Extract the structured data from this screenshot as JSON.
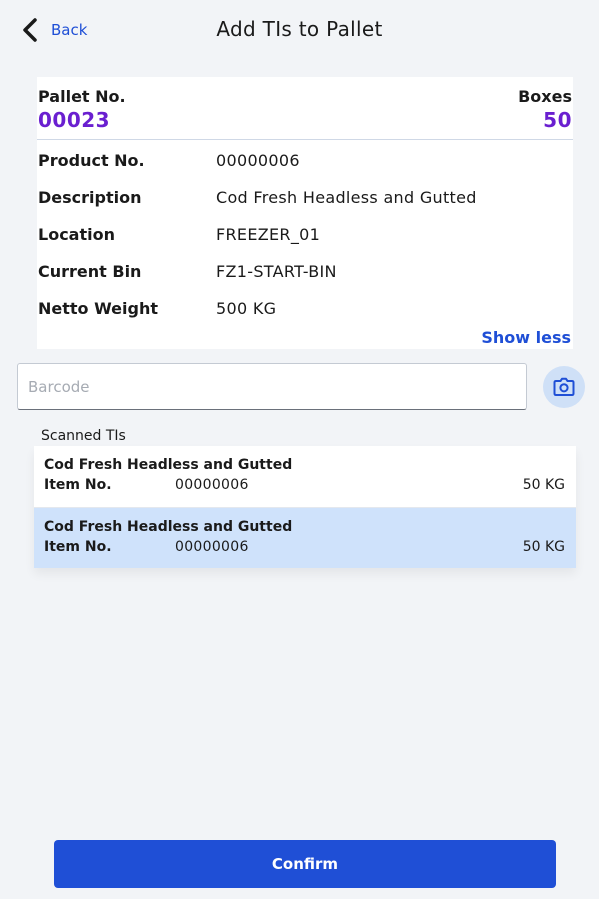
{
  "header": {
    "back_label": "Back",
    "title": "Add TIs to Pallet"
  },
  "pallet": {
    "pallet_no_label": "Pallet No.",
    "pallet_no": "00023",
    "boxes_label": "Boxes",
    "boxes": "50",
    "details": [
      {
        "key": "Product No.",
        "value": "00000006"
      },
      {
        "key": "Description",
        "value": "Cod Fresh Headless and Gutted"
      },
      {
        "key": "Location",
        "value": "FREEZER_01"
      },
      {
        "key": "Current Bin",
        "value": "FZ1-START-BIN"
      },
      {
        "key": "Netto Weight",
        "value": "500 KG"
      }
    ],
    "show_less_label": "Show less"
  },
  "barcode": {
    "placeholder": "Barcode",
    "value": ""
  },
  "scanned": {
    "title": "Scanned TIs",
    "items": [
      {
        "description": "Cod Fresh Headless and Gutted",
        "item_no_label": "Item No.",
        "item_no": "00000006",
        "weight": "50 KG",
        "selected": false
      },
      {
        "description": "Cod Fresh Headless and Gutted",
        "item_no_label": "Item No.",
        "item_no": "00000006",
        "weight": "50 KG",
        "selected": true
      }
    ]
  },
  "confirm_label": "Confirm",
  "icons": {
    "back": "chevron-left-icon",
    "camera": "camera-icon"
  },
  "colors": {
    "accent": "#1f4fd6",
    "pallet_value": "#6a1fd0",
    "selected_row": "#cfe2fb",
    "background": "#f2f4f7"
  }
}
